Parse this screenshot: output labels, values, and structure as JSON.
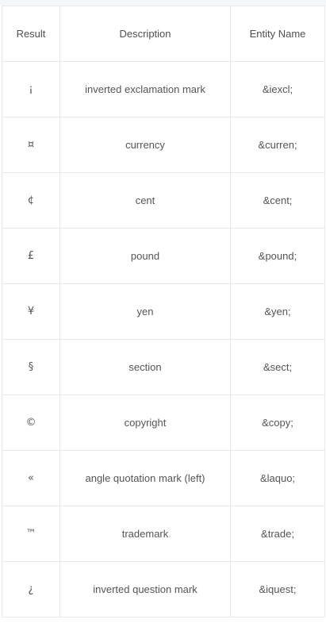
{
  "table": {
    "headers": {
      "result": "Result",
      "description": "Description",
      "entity_name": "Entity Name"
    },
    "rows": [
      {
        "result": "¡",
        "description": "inverted exclamation mark",
        "entity": "&iexcl;"
      },
      {
        "result": "¤",
        "description": "currency",
        "entity": "&curren;"
      },
      {
        "result": "¢",
        "description": "cent",
        "entity": "&cent;"
      },
      {
        "result": "£",
        "description": "pound",
        "entity": "&pound;"
      },
      {
        "result": "¥",
        "description": "yen",
        "entity": "&yen;"
      },
      {
        "result": "§",
        "description": "section",
        "entity": "&sect;"
      },
      {
        "result": "©",
        "description": "copyright",
        "entity": "&copy;"
      },
      {
        "result": "«",
        "description": "angle quotation mark (left)",
        "entity": "&laquo;"
      },
      {
        "result": "™",
        "description": "trademark",
        "entity": "&trade;"
      },
      {
        "result": "¿",
        "description": "inverted question mark",
        "entity": "&iquest;"
      }
    ]
  }
}
